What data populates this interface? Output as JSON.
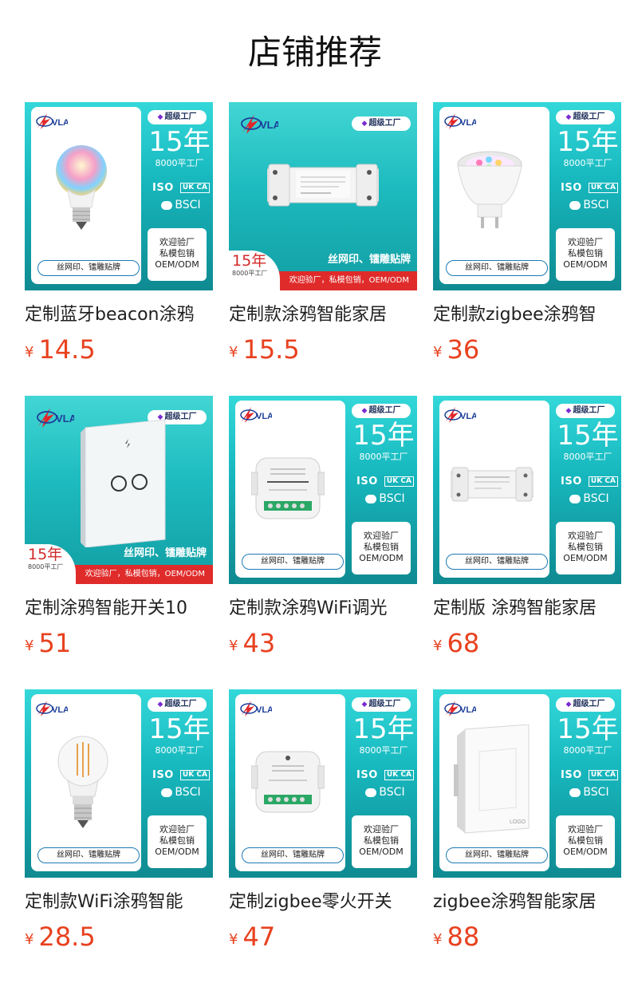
{
  "page_title": "店铺推荐",
  "common": {
    "badge": "超级工厂",
    "years": "15年",
    "area": "8000平工厂",
    "iso": "ISO",
    "ukca": "UK CA",
    "bsci": "BSCI",
    "oem_line1": "欢迎验厂",
    "oem_line2": "私模包销",
    "oem_line3": "OEM/ODM",
    "footer": "丝网印、镭雕贴牌",
    "red_caption": "丝网印、镭雕贴牌",
    "red_strip": "欢迎验厂，私模包销，OEM/ODM",
    "red_years": "15年",
    "red_area": "8000平工厂",
    "currency": "¥"
  },
  "products": [
    {
      "name": "定制蓝牙beacon涂鸦",
      "price": "14.5",
      "style": "white",
      "icon": "rgb-bulb-icon"
    },
    {
      "name": "定制款涂鸦智能家居",
      "price": "15.5",
      "style": "red",
      "icon": "wifi-switch-module-icon"
    },
    {
      "name": "定制款zigbee涂鸦智",
      "price": "36",
      "style": "white",
      "icon": "gu10-spotlight-icon"
    },
    {
      "name": "定制涂鸦智能开关10",
      "price": "51",
      "style": "red",
      "icon": "wall-touch-switch-icon"
    },
    {
      "name": "定制款涂鸦WiFi调光",
      "price": "43",
      "style": "white",
      "icon": "dimmer-module-icon"
    },
    {
      "name": "定制版 涂鸦智能家居",
      "price": "68",
      "style": "white",
      "icon": "garage-controller-icon"
    },
    {
      "name": "定制款WiFi涂鸦智能",
      "price": "28.5",
      "style": "white",
      "icon": "filament-bulb-icon"
    },
    {
      "name": "定制zigbee零火开关",
      "price": "47",
      "style": "white",
      "icon": "switch-module-icon"
    },
    {
      "name": "zigbee涂鸦智能家居",
      "price": "88",
      "style": "white",
      "icon": "wall-panel-switch-icon"
    }
  ]
}
